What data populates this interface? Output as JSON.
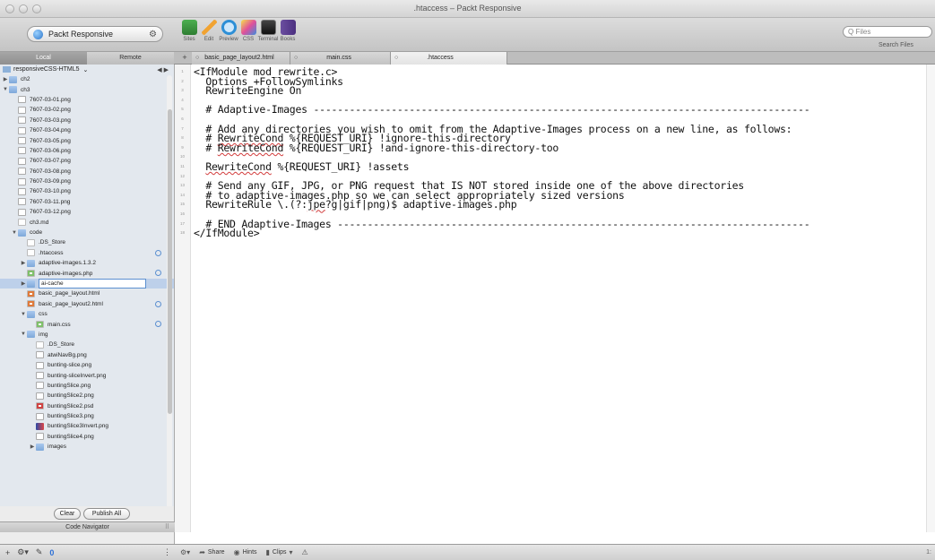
{
  "window": {
    "title": ".htaccess – Packt Responsive"
  },
  "toolbar": {
    "site_name": "Packt Responsive",
    "tools": [
      {
        "label": "Sites",
        "icon": "sites-icon"
      },
      {
        "label": "Edit",
        "icon": "edit-pencil-icon"
      },
      {
        "label": "Preview",
        "icon": "preview-magnifier-icon"
      },
      {
        "label": "CSS",
        "icon": "css-icon"
      },
      {
        "label": "Terminal",
        "icon": "terminal-icon"
      },
      {
        "label": "Books",
        "icon": "books-icon"
      }
    ],
    "search_placeholder": "Q Files",
    "search_label": "Search Files"
  },
  "sidebar_tabs": {
    "local": "Local",
    "remote": "Remote"
  },
  "doc_tabs": [
    {
      "label": "basic_page_layout2.html"
    },
    {
      "label": "main.css"
    },
    {
      "label": ".htaccess"
    }
  ],
  "sidebar": {
    "path": "responsiveCSS-HTML5",
    "tree": [
      {
        "name": "ch2",
        "depth": 0,
        "type": "folder",
        "disclosure": "▶"
      },
      {
        "name": "ch3",
        "depth": 0,
        "type": "folder",
        "disclosure": "▼"
      },
      {
        "name": "7607-03-01.png",
        "depth": 1,
        "type": "png"
      },
      {
        "name": "7607-03-02.png",
        "depth": 1,
        "type": "png"
      },
      {
        "name": "7607-03-03.png",
        "depth": 1,
        "type": "png"
      },
      {
        "name": "7607-03-04.png",
        "depth": 1,
        "type": "png"
      },
      {
        "name": "7607-03-05.png",
        "depth": 1,
        "type": "png"
      },
      {
        "name": "7607-03-06.png",
        "depth": 1,
        "type": "png"
      },
      {
        "name": "7607-03-07.png",
        "depth": 1,
        "type": "png"
      },
      {
        "name": "7607-03-08.png",
        "depth": 1,
        "type": "png"
      },
      {
        "name": "7607-03-09.png",
        "depth": 1,
        "type": "png"
      },
      {
        "name": "7607-03-10.png",
        "depth": 1,
        "type": "png"
      },
      {
        "name": "7607-03-11.png",
        "depth": 1,
        "type": "png"
      },
      {
        "name": "7607-03-12.png",
        "depth": 1,
        "type": "png"
      },
      {
        "name": "ch3.md",
        "depth": 1,
        "type": "file"
      },
      {
        "name": "code",
        "depth": 1,
        "type": "folder",
        "disclosure": "▼"
      },
      {
        "name": ".DS_Store",
        "depth": 2,
        "type": "file"
      },
      {
        "name": ".htaccess",
        "depth": 2,
        "type": "file",
        "badge": true
      },
      {
        "name": "adaptive-images.1.3.2",
        "depth": 2,
        "type": "folder",
        "disclosure": "▶"
      },
      {
        "name": "adaptive-images.php",
        "depth": 2,
        "type": "php",
        "badge": true
      },
      {
        "name": "ai-cache",
        "depth": 2,
        "type": "folder",
        "disclosure": "▶",
        "selected": true
      },
      {
        "name": "basic_page_layout.html",
        "depth": 2,
        "type": "html"
      },
      {
        "name": "basic_page_layout2.html",
        "depth": 2,
        "type": "html",
        "badge": true
      },
      {
        "name": "css",
        "depth": 2,
        "type": "folder",
        "disclosure": "▼"
      },
      {
        "name": "main.css",
        "depth": 3,
        "type": "php",
        "badge": true
      },
      {
        "name": "img",
        "depth": 2,
        "type": "folder",
        "disclosure": "▼"
      },
      {
        "name": ".DS_Store",
        "depth": 3,
        "type": "file"
      },
      {
        "name": "atwiNavBg.png",
        "depth": 3,
        "type": "png"
      },
      {
        "name": "bunting-slice.png",
        "depth": 3,
        "type": "png"
      },
      {
        "name": "bunting-sliceInvert.png",
        "depth": 3,
        "type": "png"
      },
      {
        "name": "buntingSlice.png",
        "depth": 3,
        "type": "png"
      },
      {
        "name": "buntingSlice2.png",
        "depth": 3,
        "type": "png"
      },
      {
        "name": "buntingSlice2.psd",
        "depth": 3,
        "type": "psd"
      },
      {
        "name": "buntingSlice3.png",
        "depth": 3,
        "type": "png"
      },
      {
        "name": "buntingSlice3Invert.png",
        "depth": 3,
        "type": "img"
      },
      {
        "name": "buntingSlice4.png",
        "depth": 3,
        "type": "png"
      },
      {
        "name": "images",
        "depth": 3,
        "type": "folder",
        "disclosure": "▶"
      }
    ],
    "clear_label": "Clear",
    "publish_label": "Publish All",
    "code_navigator_label": "Code Navigator"
  },
  "editor": {
    "lines": [
      "<IfModule mod_rewrite.c>",
      "  Options +FollowSymlinks",
      "  RewriteEngine On",
      "",
      "  # Adaptive-Images -----------------------------------------------------------------------------------",
      "",
      "  # Add any directories you wish to omit from the Adaptive-Images process on a new line, as follows:",
      "  # RewriteCond %{REQUEST_URI} !ignore-this-directory",
      "  # RewriteCond %{REQUEST_URI} !and-ignore-this-directory-too",
      "",
      "  RewriteCond %{REQUEST_URI} !assets",
      "",
      "  # Send any GIF, JPG, or PNG request that IS NOT stored inside one of the above directories",
      "  # to adaptive-images.php so we can select appropriately sized versions",
      "  RewriteRule \\.(?:jpe?g|gif|png)$ adaptive-images.php",
      "",
      "  # END Adaptive-Images -------------------------------------------------------------------------------",
      "</IfModule>"
    ],
    "line_count": 18
  },
  "statusbar": {
    "share": "Share",
    "hints": "Hints",
    "clips": "Clips",
    "end_text": "1:"
  }
}
